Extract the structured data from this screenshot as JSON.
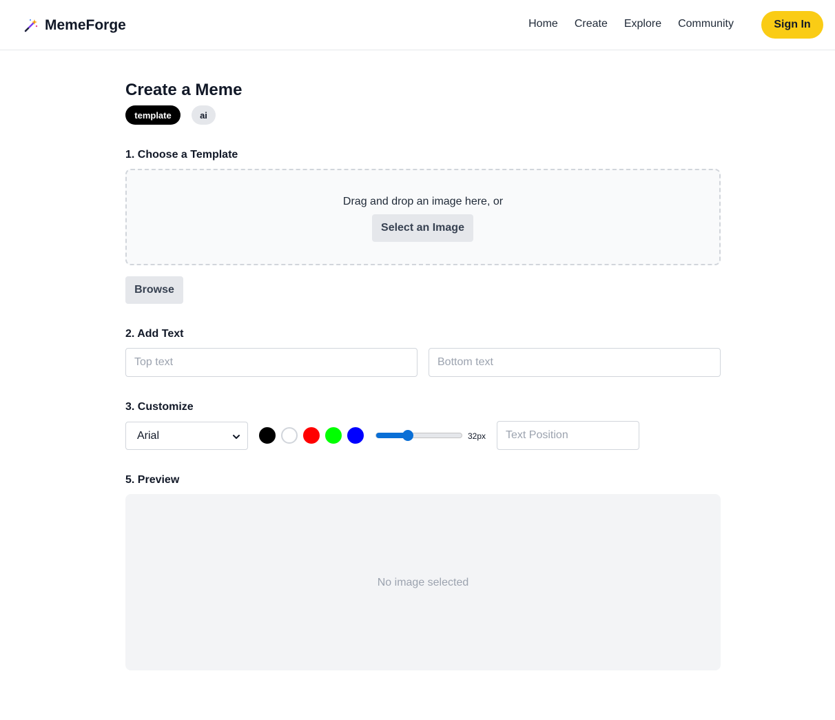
{
  "brand": {
    "name": "MemeForge",
    "icon": "magic-wand-icon"
  },
  "nav": {
    "links": [
      "Home",
      "Create",
      "Explore",
      "Community"
    ],
    "signin_label": "Sign In"
  },
  "page": {
    "title": "Create a Meme",
    "modes": [
      {
        "label": "template",
        "active": true
      },
      {
        "label": "ai",
        "active": false
      }
    ]
  },
  "template_section": {
    "label": "1. Choose a Template",
    "drop_text": "Drag and drop an image here, or",
    "select_button": "Select an Image",
    "browse_button": "Browse"
  },
  "text_section": {
    "label": "2. Add Text",
    "top_placeholder": "Top text",
    "bottom_placeholder": "Bottom text"
  },
  "customize_section": {
    "label": "3. Customize",
    "font_selected": "Arial",
    "colors": [
      "#000000",
      "#ffffff",
      "#ff0000",
      "#00ff00",
      "#0000ff"
    ],
    "font_size_label": "32px",
    "font_size_slider_fraction": 0.35,
    "position_placeholder": "Text Position"
  },
  "preview_section": {
    "label": "5. Preview",
    "empty_text": "No image selected"
  },
  "accent": {
    "signin_bg": "#facc15",
    "slider": "#0a6fd6"
  }
}
